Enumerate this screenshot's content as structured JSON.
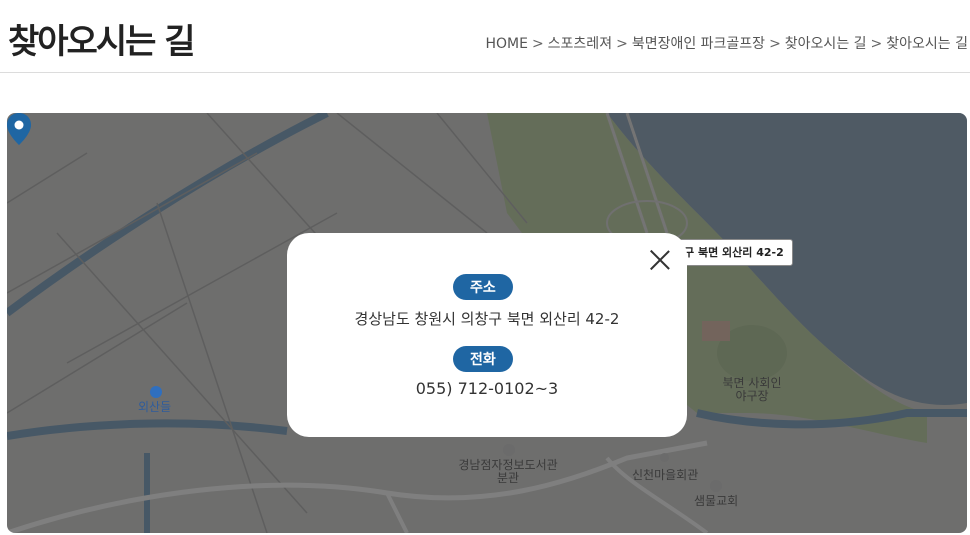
{
  "page": {
    "title": "찾아오시는 길"
  },
  "breadcrumb": {
    "items": [
      "HOME",
      "스포츠레져",
      "북면장애인 파크골프장",
      "찾아오시는 길",
      "찾아오시는 길"
    ],
    "separator": ">"
  },
  "map": {
    "marker_label": "구 북면 외산리 42-2",
    "labels": {
      "place_oesandeul": "외산들",
      "place_info_library": "경남점자정보도서관 분관",
      "place_village_hall": "신천마을회관",
      "place_church": "샘물교회",
      "place_baseball": "북면 사회인야구장"
    },
    "colors": {
      "land": "#dcdcda",
      "water": "#9fb5c8",
      "park": "#c9dab3",
      "road": "#ffffff",
      "marker": "#1f66a3"
    }
  },
  "popup": {
    "address_label": "주소",
    "address_value": "경상남도 창원시 의창구 북면 외산리 42-2",
    "phone_label": "전화",
    "phone_value": "055) 712-0102~3",
    "accent_color": "#1f66a3",
    "close_icon": "close-icon"
  }
}
